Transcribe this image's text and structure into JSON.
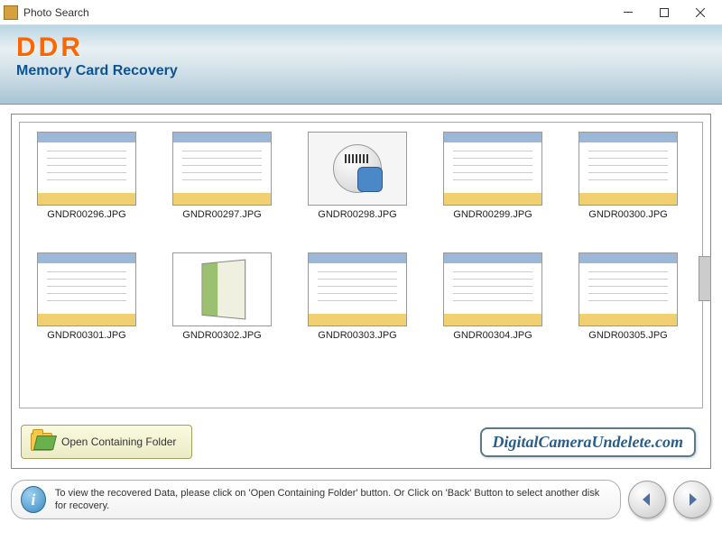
{
  "window": {
    "title": "Photo Search"
  },
  "header": {
    "logo": "DDR",
    "subtitle": "Memory Card Recovery"
  },
  "thumbnails": [
    {
      "filename": "GNDR00296.JPG",
      "variant": "screen"
    },
    {
      "filename": "GNDR00297.JPG",
      "variant": "screen"
    },
    {
      "filename": "GNDR00298.JPG",
      "variant": "finder"
    },
    {
      "filename": "GNDR00299.JPG",
      "variant": "screen"
    },
    {
      "filename": "GNDR00300.JPG",
      "variant": "screen"
    },
    {
      "filename": "GNDR00301.JPG",
      "variant": "screen"
    },
    {
      "filename": "GNDR00302.JPG",
      "variant": "box"
    },
    {
      "filename": "GNDR00303.JPG",
      "variant": "screen"
    },
    {
      "filename": "GNDR00304.JPG",
      "variant": "screen"
    },
    {
      "filename": "GNDR00305.JPG",
      "variant": "screen"
    }
  ],
  "actions": {
    "open_folder_label": "Open Containing Folder"
  },
  "watermark": "DigitalCameraUndelete.com",
  "footer": {
    "info_text": "To view the recovered Data, please click on 'Open Containing Folder' button. Or Click on 'Back' Button to select another disk for recovery."
  }
}
